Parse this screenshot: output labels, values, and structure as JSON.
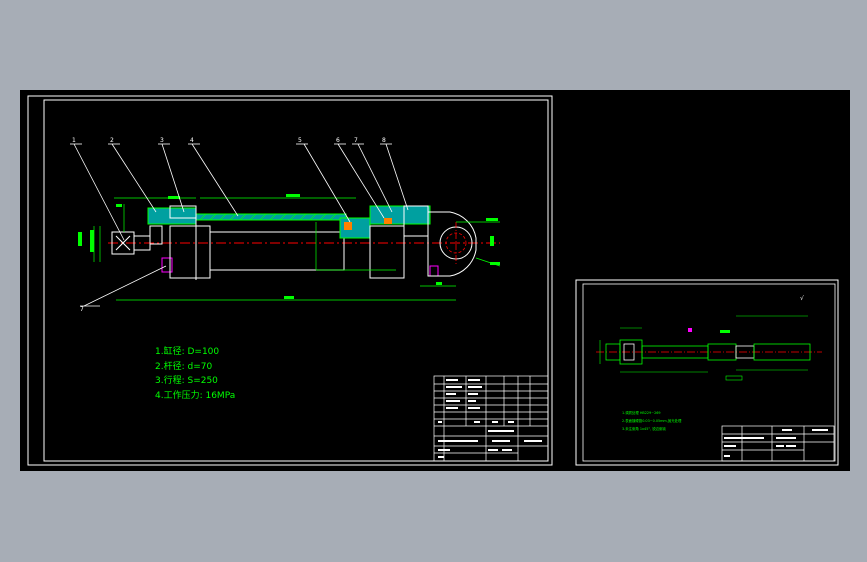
{
  "main_drawing": {
    "notes": [
      "1.缸径: D=100",
      "2.杆径: d=70",
      "3.行程: S=250",
      "4.工作压力: 16MPa"
    ],
    "part_numbers": [
      "1",
      "2",
      "3",
      "4",
      "5",
      "6",
      "7",
      "8",
      "7"
    ]
  },
  "detail_drawing": {
    "notes": [
      "1.调质处理 HB229~269",
      "2.表面镀硬铬0.03~0.05mm,抛光处理",
      "3.未注倒角 1x45°, 锐边倒钝"
    ]
  },
  "colors": {
    "background": "#000000",
    "frame": "#ffffff",
    "outline": "#00ff00",
    "centerline": "#ff0000",
    "hatch": "#00bfbf",
    "dimension": "#00ff00",
    "leader": "#ffffff"
  }
}
